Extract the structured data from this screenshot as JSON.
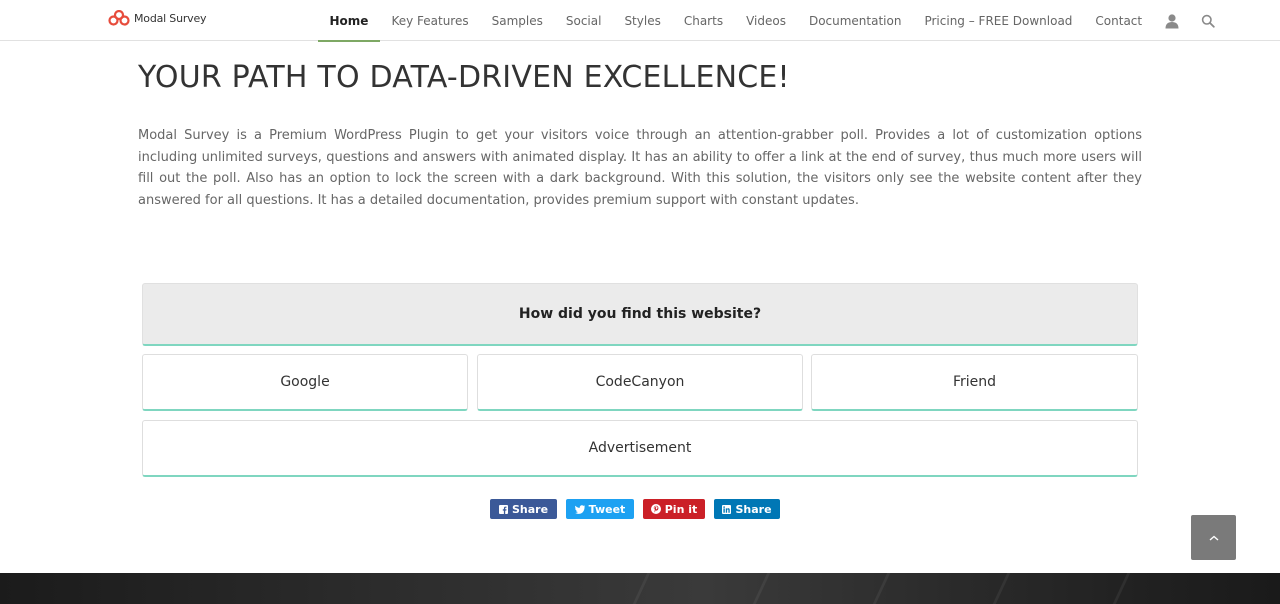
{
  "header": {
    "logo_text": "Modal Survey",
    "nav": [
      {
        "label": "Home",
        "active": true
      },
      {
        "label": "Key Features",
        "active": false
      },
      {
        "label": "Samples",
        "active": false
      },
      {
        "label": "Social",
        "active": false
      },
      {
        "label": "Styles",
        "active": false
      },
      {
        "label": "Charts",
        "active": false
      },
      {
        "label": "Videos",
        "active": false
      },
      {
        "label": "Documentation",
        "active": false
      },
      {
        "label": "Pricing – FREE Download",
        "active": false
      },
      {
        "label": "Contact",
        "active": false
      }
    ],
    "icons": [
      "user-icon",
      "search-icon"
    ]
  },
  "main": {
    "title": "YOUR PATH TO DATA-DRIVEN EXCELLENCE!",
    "intro": "Modal Survey is a Premium WordPress Plugin to get your visitors voice through an attention-grabber poll. Provides a lot of customization options including unlimited surveys, questions and answers with animated display. It has an ability to offer a link at the end of survey, thus much more users will fill out the poll. Also has an option to lock the screen with a dark background. With this solution, the visitors only see the website content after they answered for all questions. It has a detailed documentation, provides premium support with constant updates."
  },
  "survey": {
    "question": "How did you find this website?",
    "answers": [
      "Google",
      "CodeCanyon",
      "Friend",
      "Advertisement"
    ]
  },
  "share": {
    "facebook": {
      "label": "Share",
      "icon": "facebook-icon",
      "color": "#3b5998"
    },
    "twitter": {
      "label": "Tweet",
      "icon": "twitter-icon",
      "color": "#1da1f2"
    },
    "pinterest": {
      "label": "Pin it",
      "icon": "pinterest-icon",
      "color": "#cb2027"
    },
    "linkedin": {
      "label": "Share",
      "icon": "linkedin-icon",
      "color": "#0077b5"
    }
  },
  "colors": {
    "accent_green": "#7ea864",
    "answer_border": "#7fd6c0",
    "scroll_top_bg": "#7a7a7a"
  }
}
